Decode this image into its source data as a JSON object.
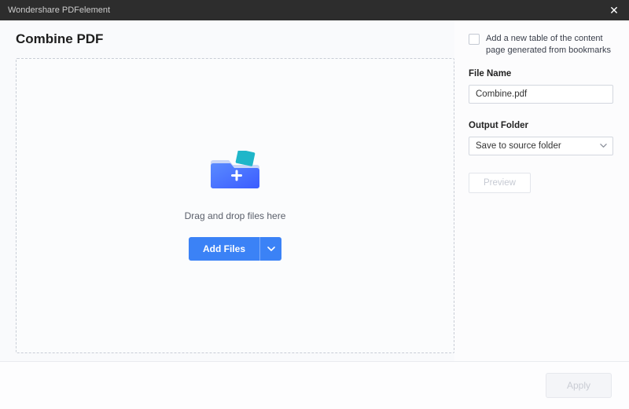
{
  "window": {
    "title": "Wondershare PDFelement"
  },
  "page": {
    "heading": "Combine PDF"
  },
  "dropzone": {
    "hint": "Drag and drop files here",
    "add_button": "Add Files"
  },
  "options": {
    "checkbox_label": "Add a new table of the content page generated from bookmarks",
    "filename_label": "File Name",
    "filename_value": "Combine.pdf",
    "output_label": "Output Folder",
    "output_value": "Save to source folder",
    "preview_button": "Preview"
  },
  "footer": {
    "apply_button": "Apply"
  }
}
